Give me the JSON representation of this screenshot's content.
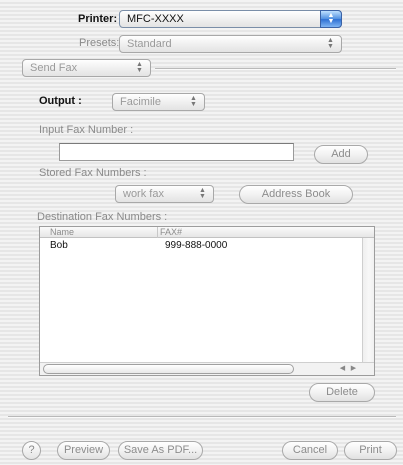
{
  "printer": {
    "label": "Printer:",
    "value": "MFC-XXXX"
  },
  "presets": {
    "label": "Presets:",
    "value": "Standard"
  },
  "panel_select": {
    "value": "Send Fax"
  },
  "output": {
    "label": "Output :",
    "value": "Facimile"
  },
  "input_fax": {
    "label": "Input Fax Number :",
    "value": "",
    "add_label": "Add"
  },
  "stored": {
    "label": "Stored Fax Numbers :",
    "value": "work fax",
    "address_book_label": "Address Book"
  },
  "destination": {
    "label": "Destination Fax Numbers :",
    "columns": [
      "Name",
      "FAX#"
    ],
    "rows": [
      {
        "name": "Bob",
        "fax": "999-888-0000"
      }
    ],
    "delete_label": "Delete"
  },
  "footer": {
    "help_label": "?",
    "preview_label": "Preview",
    "save_pdf_label": "Save As PDF...",
    "cancel_label": "Cancel",
    "print_label": "Print"
  },
  "icons": {
    "popup_arrows": "up-down-arrows-icon",
    "help": "question-mark-icon"
  }
}
